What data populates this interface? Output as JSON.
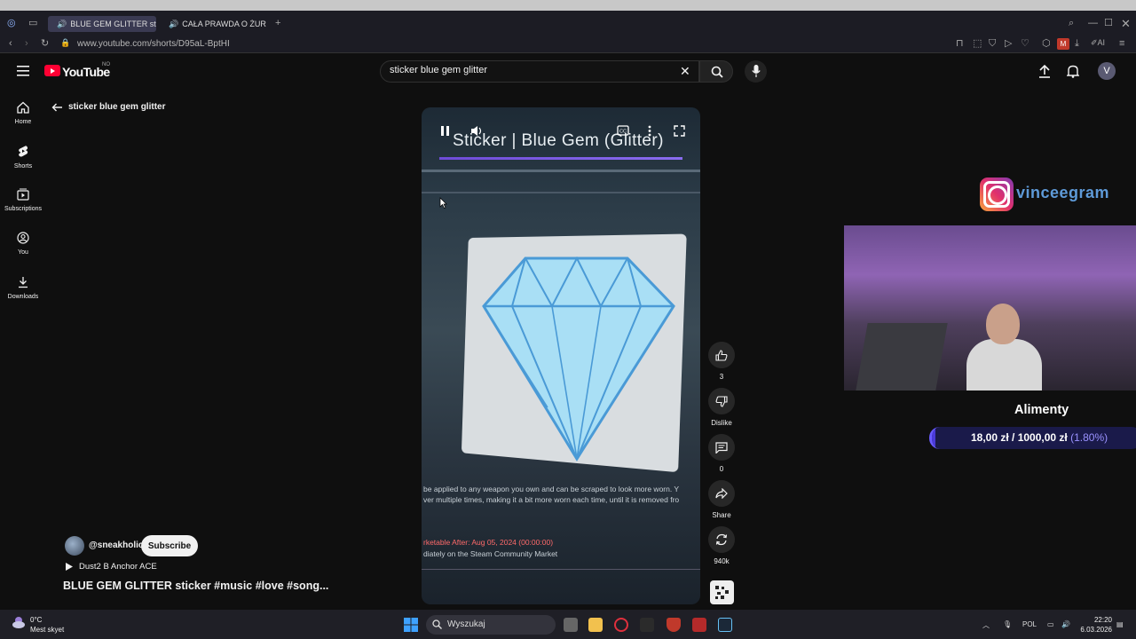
{
  "browser": {
    "tabs": [
      {
        "label": "BLUE GEM GLITTER st",
        "active": true
      },
      {
        "label": "CAŁA PRAWDA O ŻUR",
        "active": false
      }
    ],
    "url": "www.youtube.com/shorts/D95aL-BptHI"
  },
  "youtube": {
    "logo": "YouTube",
    "region": "NO",
    "search_query": "sticker blue gem glitter",
    "avatar_letter": "V",
    "back_label": "sticker blue gem glitter"
  },
  "sidebar": {
    "items": [
      {
        "label": "Home",
        "icon": "home-icon"
      },
      {
        "label": "Shorts",
        "icon": "shorts-icon"
      },
      {
        "label": "Subscriptions",
        "icon": "subscriptions-icon"
      },
      {
        "label": "You",
        "icon": "you-icon"
      },
      {
        "label": "Downloads",
        "icon": "download-icon"
      }
    ]
  },
  "video": {
    "overlay_title": "Sticker | Blue Gem (Glitter)",
    "line1": "be applied to any weapon you own and can be scraped to look more worn. Y",
    "line2": "ver multiple times, making it a bit more worn each time, until it is removed fro",
    "line3": "rketable After: Aug 05, 2024 (00:00:00)",
    "line4": "diately on the Steam Community Market"
  },
  "actions": {
    "likes": "3",
    "dislike_label": "Dislike",
    "comments": "0",
    "share_label": "Share",
    "remix": "940k"
  },
  "channel": {
    "handle": "@sneakholic",
    "subscribe_label": "Subscribe",
    "music": "Dust2 B Anchor ACE",
    "title": "BLUE GEM GLITTER sticker #music #love #song..."
  },
  "overlay": {
    "instagram": "vinceegram",
    "goal_title": "Alimenty",
    "goal_amount": "18,00 zł / 1000,00 zł",
    "goal_percent": "(1.80%)",
    "goal_fraction": 0.018
  },
  "taskbar": {
    "weather_temp": "0°C",
    "weather_desc": "Mest skyet",
    "search_placeholder": "Wyszukaj",
    "language": "POL",
    "time": "22:20",
    "date": "6.03.2026"
  }
}
